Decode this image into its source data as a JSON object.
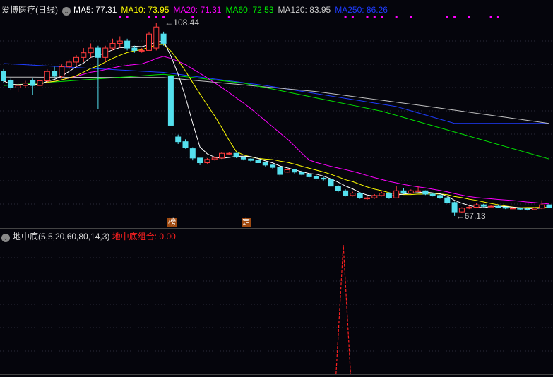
{
  "header": {
    "stock": "爱博医疗(日线)",
    "ma5": "MA5: 77.31",
    "ma10": "MA10: 73.95",
    "ma20": "MA20: 71.31",
    "ma60": "MA60: 72.53",
    "ma120": "MA120: 83.95",
    "ma250": "MA250: 86.26"
  },
  "indicator": {
    "name": "地中底(5,5,20,60,80,14,3)",
    "value": "地中底组合: 0.00"
  },
  "tags": [
    {
      "text": "榜",
      "index": 23
    },
    {
      "text": "定",
      "index": 33
    }
  ],
  "colors": {
    "up": "#ff3c3c",
    "down": "#54e0ee",
    "ma5": "#ffffff",
    "ma10": "#ffff00",
    "ma20": "#ff00ff",
    "ma60": "#00e000",
    "ma120": "#c0c0c0",
    "ma250": "#1e3cff",
    "signal": "#ff00ff"
  },
  "chart_data": {
    "type": "candlestick",
    "high_label": "108.44",
    "low_label": "67.13",
    "ylim": [
      65,
      112
    ],
    "ohlc": [
      [
        98,
        98.5,
        95.5,
        96
      ],
      [
        96,
        96.5,
        94,
        94.5
      ],
      [
        94.5,
        95.5,
        93.5,
        95
      ],
      [
        95,
        96,
        94.5,
        95.5
      ],
      [
        96,
        96.5,
        93,
        95
      ],
      [
        95,
        96.5,
        94.5,
        96
      ],
      [
        96,
        98.5,
        95.5,
        98
      ],
      [
        98,
        99,
        96.5,
        97
      ],
      [
        97,
        99.5,
        96.5,
        99
      ],
      [
        99,
        100.5,
        98.5,
        100
      ],
      [
        100,
        101.5,
        99,
        101
      ],
      [
        101,
        103,
        100,
        102
      ],
      [
        102,
        104,
        101,
        103
      ],
      [
        103,
        103.5,
        90,
        101
      ],
      [
        101,
        103.5,
        100,
        103
      ],
      [
        103,
        105,
        102.5,
        104
      ],
      [
        104,
        105.5,
        103,
        104.5
      ],
      [
        104.5,
        105,
        102.5,
        103
      ],
      [
        103,
        103.5,
        102,
        102.5
      ],
      [
        102.5,
        103,
        102,
        102.5
      ],
      [
        102.5,
        106.5,
        102.5,
        106
      ],
      [
        103,
        108.44,
        102.5,
        107.5
      ],
      [
        106,
        106.5,
        103.5,
        104
      ],
      [
        97,
        97,
        86.5,
        86.5
      ],
      [
        84,
        84.5,
        82.5,
        83
      ],
      [
        83,
        83.5,
        81.5,
        81.8
      ],
      [
        81.5,
        81.8,
        79,
        79.5
      ],
      [
        79.5,
        79.5,
        78,
        78.5
      ],
      [
        78.5,
        79.5,
        78.3,
        79.2
      ],
      [
        79.2,
        79.8,
        79,
        79.5
      ],
      [
        79.5,
        80.8,
        79.3,
        80.5
      ],
      [
        80.5,
        80.8,
        80.2,
        80.5
      ],
      [
        80.5,
        80.6,
        79.5,
        79.7
      ],
      [
        79.7,
        79.9,
        79,
        79.3
      ],
      [
        79.3,
        79.5,
        78.6,
        79
      ],
      [
        79,
        79.2,
        78.2,
        78.5
      ],
      [
        78.5,
        78.7,
        77.7,
        78
      ],
      [
        78,
        78.2,
        77.2,
        77.5
      ],
      [
        77.5,
        77.7,
        75.5,
        76
      ],
      [
        76.5,
        77.2,
        76.3,
        77
      ],
      [
        77,
        77.2,
        76.2,
        76.5
      ],
      [
        76.5,
        76.8,
        75.8,
        76
      ],
      [
        76,
        76.2,
        75.2,
        75.5
      ],
      [
        75.5,
        75.8,
        75,
        75.2
      ],
      [
        75.2,
        75.5,
        74.7,
        75
      ],
      [
        75,
        75.2,
        73.3,
        73.5
      ],
      [
        73.5,
        73.7,
        72.2,
        72.5
      ],
      [
        72.5,
        72.8,
        71.3,
        71.5
      ],
      [
        71.5,
        72.3,
        71.3,
        72
      ],
      [
        72,
        72.2,
        70.8,
        71
      ],
      [
        70.8,
        71.3,
        70.6,
        71
      ],
      [
        71,
        71.8,
        70.8,
        71.5
      ],
      [
        71.5,
        72.3,
        71.3,
        72
      ],
      [
        72,
        72.2,
        70.8,
        71
      ],
      [
        71,
        73.5,
        71,
        72.5
      ],
      [
        72.5,
        73,
        71.8,
        72
      ],
      [
        72,
        72.8,
        71.8,
        72.5
      ],
      [
        72.5,
        73.5,
        72.3,
        72.5
      ],
      [
        72.5,
        72.6,
        71.6,
        71.8
      ],
      [
        71.8,
        72,
        71.3,
        71.5
      ],
      [
        71.5,
        71.7,
        70.8,
        71
      ],
      [
        71,
        71.2,
        69.8,
        70
      ],
      [
        70,
        70.2,
        67.13,
        68
      ],
      [
        68,
        69,
        67.8,
        68.8
      ],
      [
        68.8,
        69.3,
        68.6,
        69
      ],
      [
        69,
        69.8,
        68.8,
        69.5
      ],
      [
        69.5,
        69.7,
        69,
        69.2
      ],
      [
        69.2,
        69.4,
        69,
        69.2
      ],
      [
        69.2,
        69.4,
        68.8,
        69
      ],
      [
        69,
        69.1,
        68.6,
        68.8
      ],
      [
        68.8,
        69,
        68.6,
        68.8
      ],
      [
        68.8,
        68.9,
        68.4,
        68.6
      ],
      [
        68.6,
        68.8,
        68.3,
        68.5
      ],
      [
        68.5,
        69,
        68.4,
        68.8
      ],
      [
        68.8,
        70.5,
        68.6,
        69.5
      ],
      [
        69.5,
        69.6,
        68.8,
        69
      ]
    ],
    "ma60": [
      [
        0,
        95
      ],
      [
        22,
        97.4
      ],
      [
        33,
        95.5
      ],
      [
        52,
        89.5
      ],
      [
        75,
        79.3
      ]
    ],
    "ma120": [
      [
        0,
        96.8
      ],
      [
        22,
        96.7
      ],
      [
        43,
        93.7
      ],
      [
        58,
        90.6
      ],
      [
        75,
        86.9
      ]
    ],
    "ma250": [
      [
        0,
        99.7
      ],
      [
        22,
        97.8
      ],
      [
        36,
        95
      ],
      [
        54,
        90.5
      ],
      [
        62,
        86.9
      ],
      [
        75,
        86.9
      ]
    ],
    "signal_dots": [
      16,
      17,
      20,
      21,
      22,
      26,
      31,
      47,
      48,
      50,
      51,
      52,
      54,
      56,
      61,
      62,
      64,
      67,
      68
    ],
    "indicator": {
      "ylim": [
        0,
        1.1
      ],
      "values_at": [
        [
          46,
          0
        ],
        [
          47,
          1
        ],
        [
          48,
          0
        ]
      ]
    }
  }
}
